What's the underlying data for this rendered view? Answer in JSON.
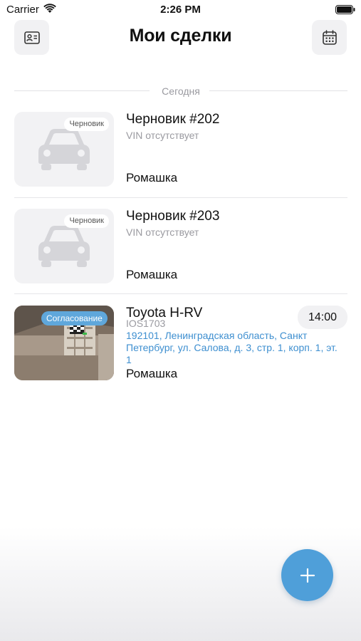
{
  "status_bar": {
    "carrier": "Carrier",
    "time": "2:26 PM"
  },
  "header": {
    "title": "Мои сделки",
    "left_icon": "contact-card-icon",
    "right_icon": "calendar-icon"
  },
  "section": {
    "label": "Сегодня"
  },
  "deals": [
    {
      "title": "Черновик #202",
      "subtitle": "VIN отсутствует",
      "company": "Ромашка",
      "badge": "Черновик",
      "thumb": "car-placeholder-icon"
    },
    {
      "title": "Черновик #203",
      "subtitle": "VIN отсутствует",
      "company": "Ромашка",
      "badge": "Черновик",
      "thumb": "car-placeholder-icon"
    },
    {
      "title": "Toyota H-RV",
      "subtitle": "IOS1703",
      "address": "192101, Ленинградская область, Санкт Петербург, ул. Салова, д. 3, стр. 1, корп. 1, эт. 1",
      "company": "Ромашка",
      "badge": "Согласование",
      "time": "14:00",
      "thumb": "vehicle-photo"
    }
  ],
  "fab": {
    "icon": "plus-icon"
  },
  "colors": {
    "accent": "#4f9fd9",
    "address": "#3e8fd0",
    "muted": "#9a9aa0",
    "chip_bg": "#f1f1f3"
  }
}
